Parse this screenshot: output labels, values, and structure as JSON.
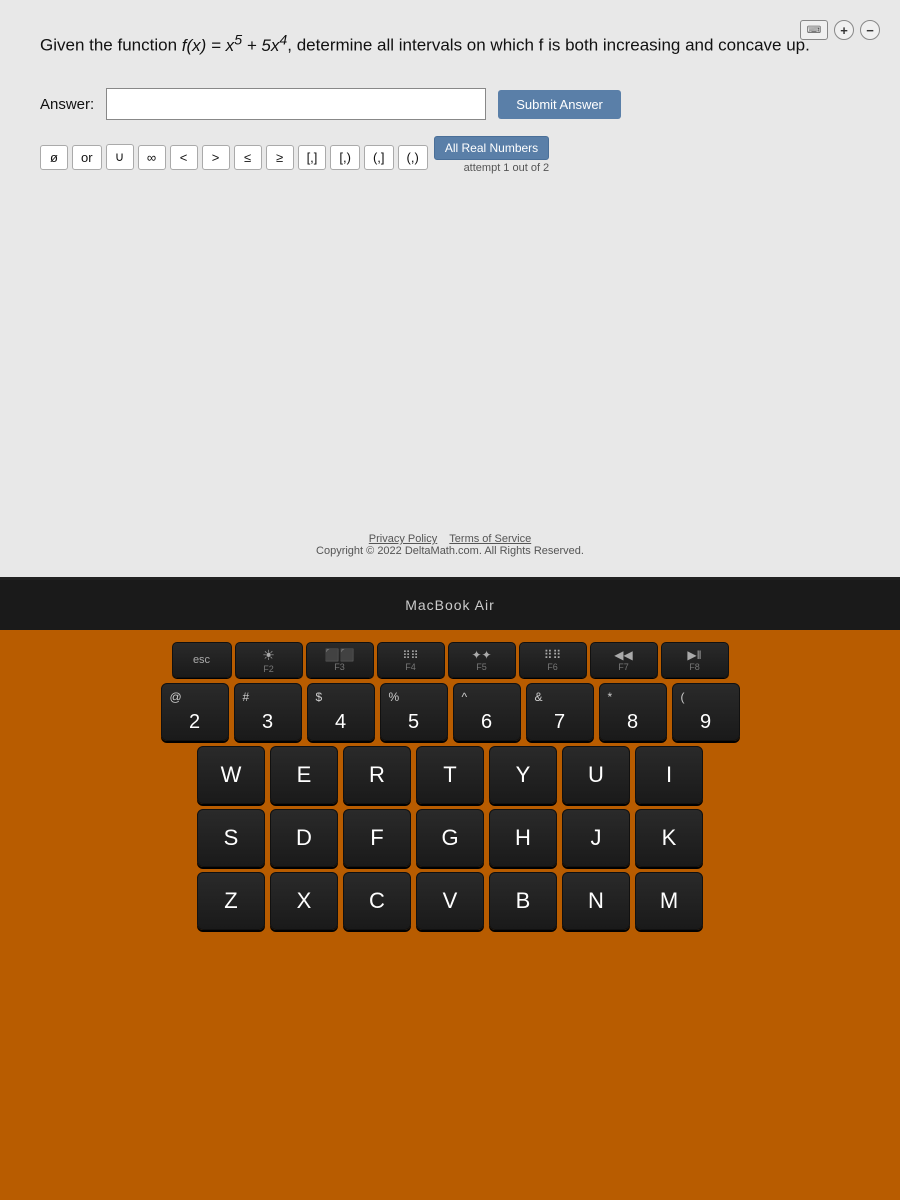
{
  "page": {
    "question": "Given the function f(x) = x⁵ + 5x⁴, determine all intervals on which f is both increasing and concave up.",
    "question_prefix": "Given the function ",
    "question_function": "f(x) = x⁵ + 5x⁴",
    "question_suffix": ", determine all intervals on which f is both increasing and concave up.",
    "answer_label": "Answer:",
    "answer_placeholder": "",
    "submit_label": "Submit Answer",
    "attempt_text": "attempt 1 out of 2",
    "all_real_label": "All Real Numbers",
    "footer_privacy": "Privacy Policy",
    "footer_terms": "Terms of Service",
    "footer_copyright": "Copyright © 2022 DeltaMath.com. All Rights Reserved.",
    "macbook_label": "MacBook Air"
  },
  "symbols": [
    {
      "id": "phi",
      "label": "ø"
    },
    {
      "id": "or",
      "label": "or"
    },
    {
      "id": "union",
      "label": "∪"
    },
    {
      "id": "infinity",
      "label": "∞"
    },
    {
      "id": "less",
      "label": "<"
    },
    {
      "id": "greater",
      "label": ">"
    },
    {
      "id": "leq",
      "label": "≤"
    },
    {
      "id": "geq",
      "label": "≥"
    },
    {
      "id": "bracket-open-close",
      "label": "[,]"
    },
    {
      "id": "bracket-open-paren",
      "label": "[,)"
    },
    {
      "id": "paren-open-close",
      "label": "(,]"
    },
    {
      "id": "paren-open-paren",
      "label": "(,)"
    }
  ],
  "keyboard": {
    "fn_row": [
      "F2",
      "F3",
      "F4",
      "F5",
      "F6",
      "F7",
      "F8"
    ],
    "fn_icons": [
      "☀",
      "⬛⬛",
      "⠿⠿",
      "✦✦",
      "✦✦",
      "◀◀",
      "▶‖"
    ],
    "num_row": [
      {
        "top": "@",
        "main": "2"
      },
      {
        "top": "#",
        "main": "3"
      },
      {
        "top": "$",
        "main": "4"
      },
      {
        "top": "%",
        "main": "5"
      },
      {
        "top": "^",
        "main": "6"
      },
      {
        "top": "&",
        "main": "7"
      },
      {
        "top": "*",
        "main": "8"
      },
      {
        "top": "(",
        "main": "9"
      }
    ],
    "row_qwerty": [
      "W",
      "E",
      "R",
      "T",
      "Y",
      "U",
      "I"
    ],
    "row_asdf": [
      "S",
      "D",
      "F",
      "G",
      "H",
      "J",
      "K"
    ],
    "row_zxcv": [
      "Z",
      "X",
      "C",
      "V",
      "B",
      "N",
      "M"
    ]
  }
}
